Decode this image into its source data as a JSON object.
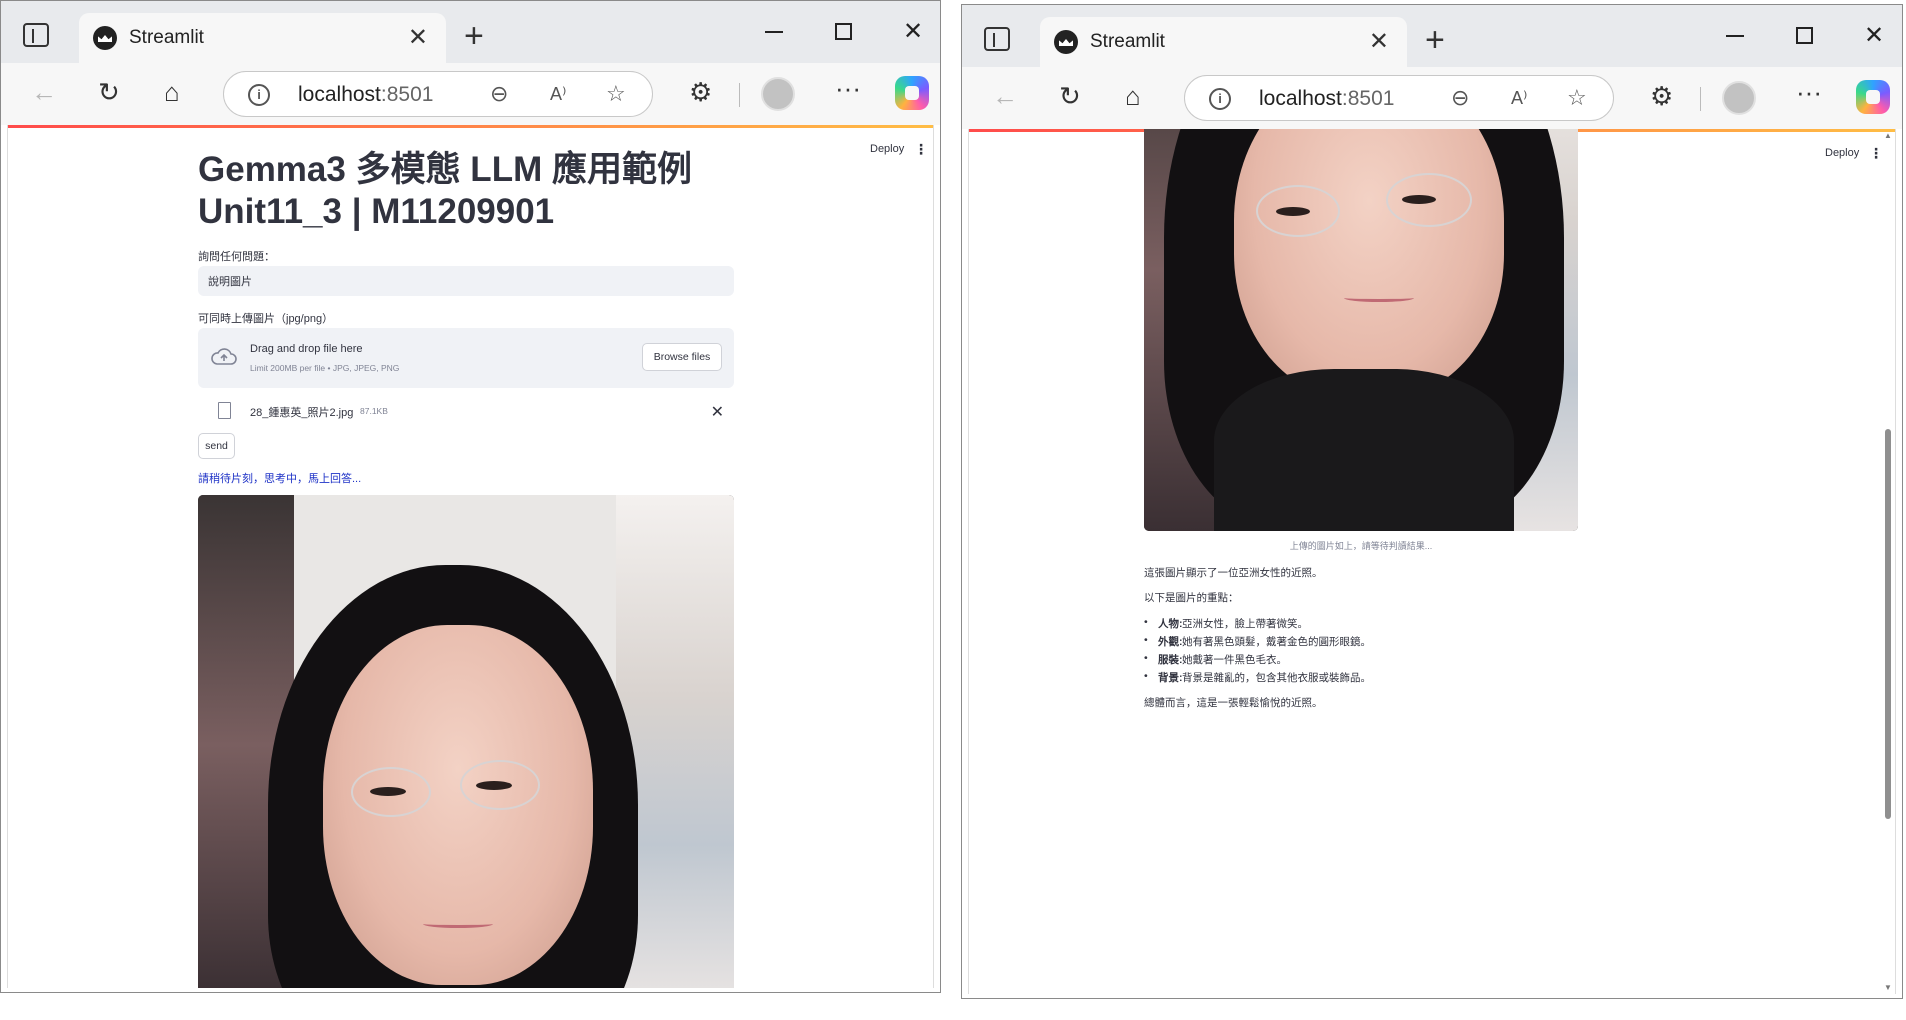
{
  "browser": {
    "tab_title": "Streamlit",
    "url_host": "localhost",
    "url_port": ":8501"
  },
  "app": {
    "deploy_label": "Deploy",
    "title_line1": "Gemma3 多模態 LLM 應用範例",
    "title_line2": "Unit11_3 | M11209901",
    "question_label": "詢問任何問題：",
    "question_value": "說明圖片",
    "upload_label": "可同時上傳圖片（jpg/png）",
    "dropzone_title": "Drag and drop file here",
    "dropzone_subtitle": "Limit 200MB per file • JPG, JPEG, PNG",
    "browse_label": "Browse files",
    "file_name": "28_鍾惠英_照片2.jpg",
    "file_size": "87.1KB",
    "send_label": "send",
    "status_text": "請稍待片刻，思考中，馬上回答..."
  },
  "result": {
    "caption": "上傳的圖片如上，請等待判讀結果...",
    "intro": "這張圖片顯示了一位亞洲女性的近照。",
    "points_heading": "以下是圖片的重點：",
    "points": [
      {
        "key": "人物:",
        "value": "亞洲女性，臉上帶著微笑。"
      },
      {
        "key": "外觀:",
        "value": "她有著黑色頭髮，戴著金色的圓形眼鏡。"
      },
      {
        "key": "服裝:",
        "value": "她戴著一件黑色毛衣。"
      },
      {
        "key": "背景:",
        "value": "背景是雜亂的，包含其他衣服或裝飾品。"
      }
    ],
    "summary": "總體而言，這是一張輕鬆愉悅的近照。"
  }
}
